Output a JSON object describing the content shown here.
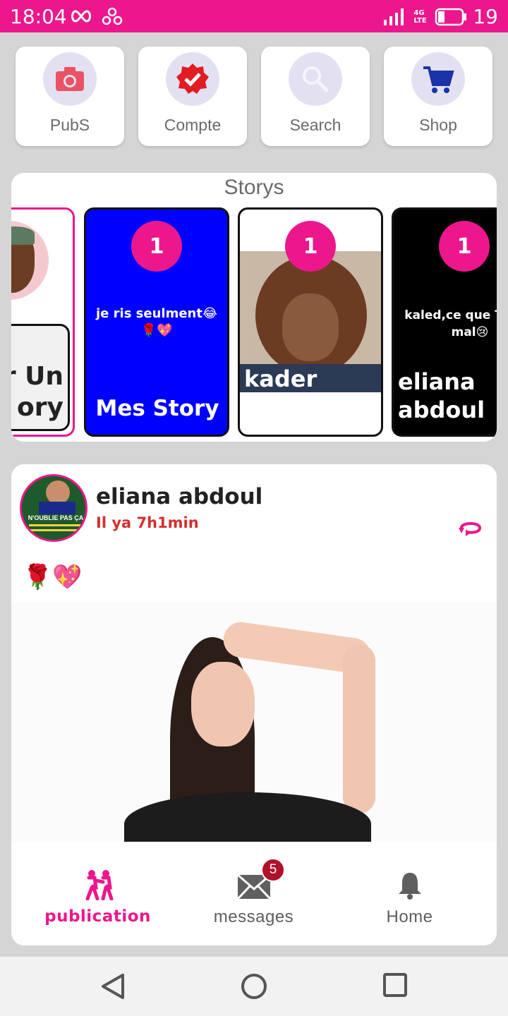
{
  "status_bar": {
    "time": "18:04",
    "network": "4G LTE",
    "battery_level": "19",
    "icons": [
      "infinity-icon",
      "share-nodes-icon",
      "signal-icon",
      "battery-icon"
    ]
  },
  "quick_actions": [
    {
      "label": "PubS",
      "icon": "camera-icon"
    },
    {
      "label": "Compte",
      "icon": "verified-badge-icon"
    },
    {
      "label": "Search",
      "icon": "search-icon"
    },
    {
      "label": "Shop",
      "icon": "shopping-cart-icon"
    }
  ],
  "stories": {
    "title": "Storys",
    "add_story": {
      "label": "er Un\nory"
    },
    "items": [
      {
        "count": "1",
        "caption": "je ris seulment😂🌹💖",
        "name": "Mes Story",
        "bg": "#0000ff"
      },
      {
        "count": "1",
        "caption": "",
        "name": "kader",
        "bg": "#ffffff"
      },
      {
        "count": "1",
        "caption": "kaled,ce que Tu est mal😢",
        "name": "eliana abdoul",
        "bg": "#000000"
      }
    ]
  },
  "post": {
    "author": "eliana abdoul",
    "time": "Il ya 7h1min",
    "content": "🌹💖",
    "avatar_text": "N'OUBLIE PAS ÇA"
  },
  "bottom_nav": {
    "items": [
      {
        "label": "publication",
        "icon": "people-icon",
        "active": true
      },
      {
        "label": "messages",
        "icon": "mail-icon",
        "badge": "5"
      },
      {
        "label": "Home",
        "icon": "bell-icon"
      }
    ]
  },
  "colors": {
    "accent": "#ec178c",
    "time_red": "#d32f2f",
    "badge_red": "#b0102a",
    "story_blue": "#0000ff"
  }
}
